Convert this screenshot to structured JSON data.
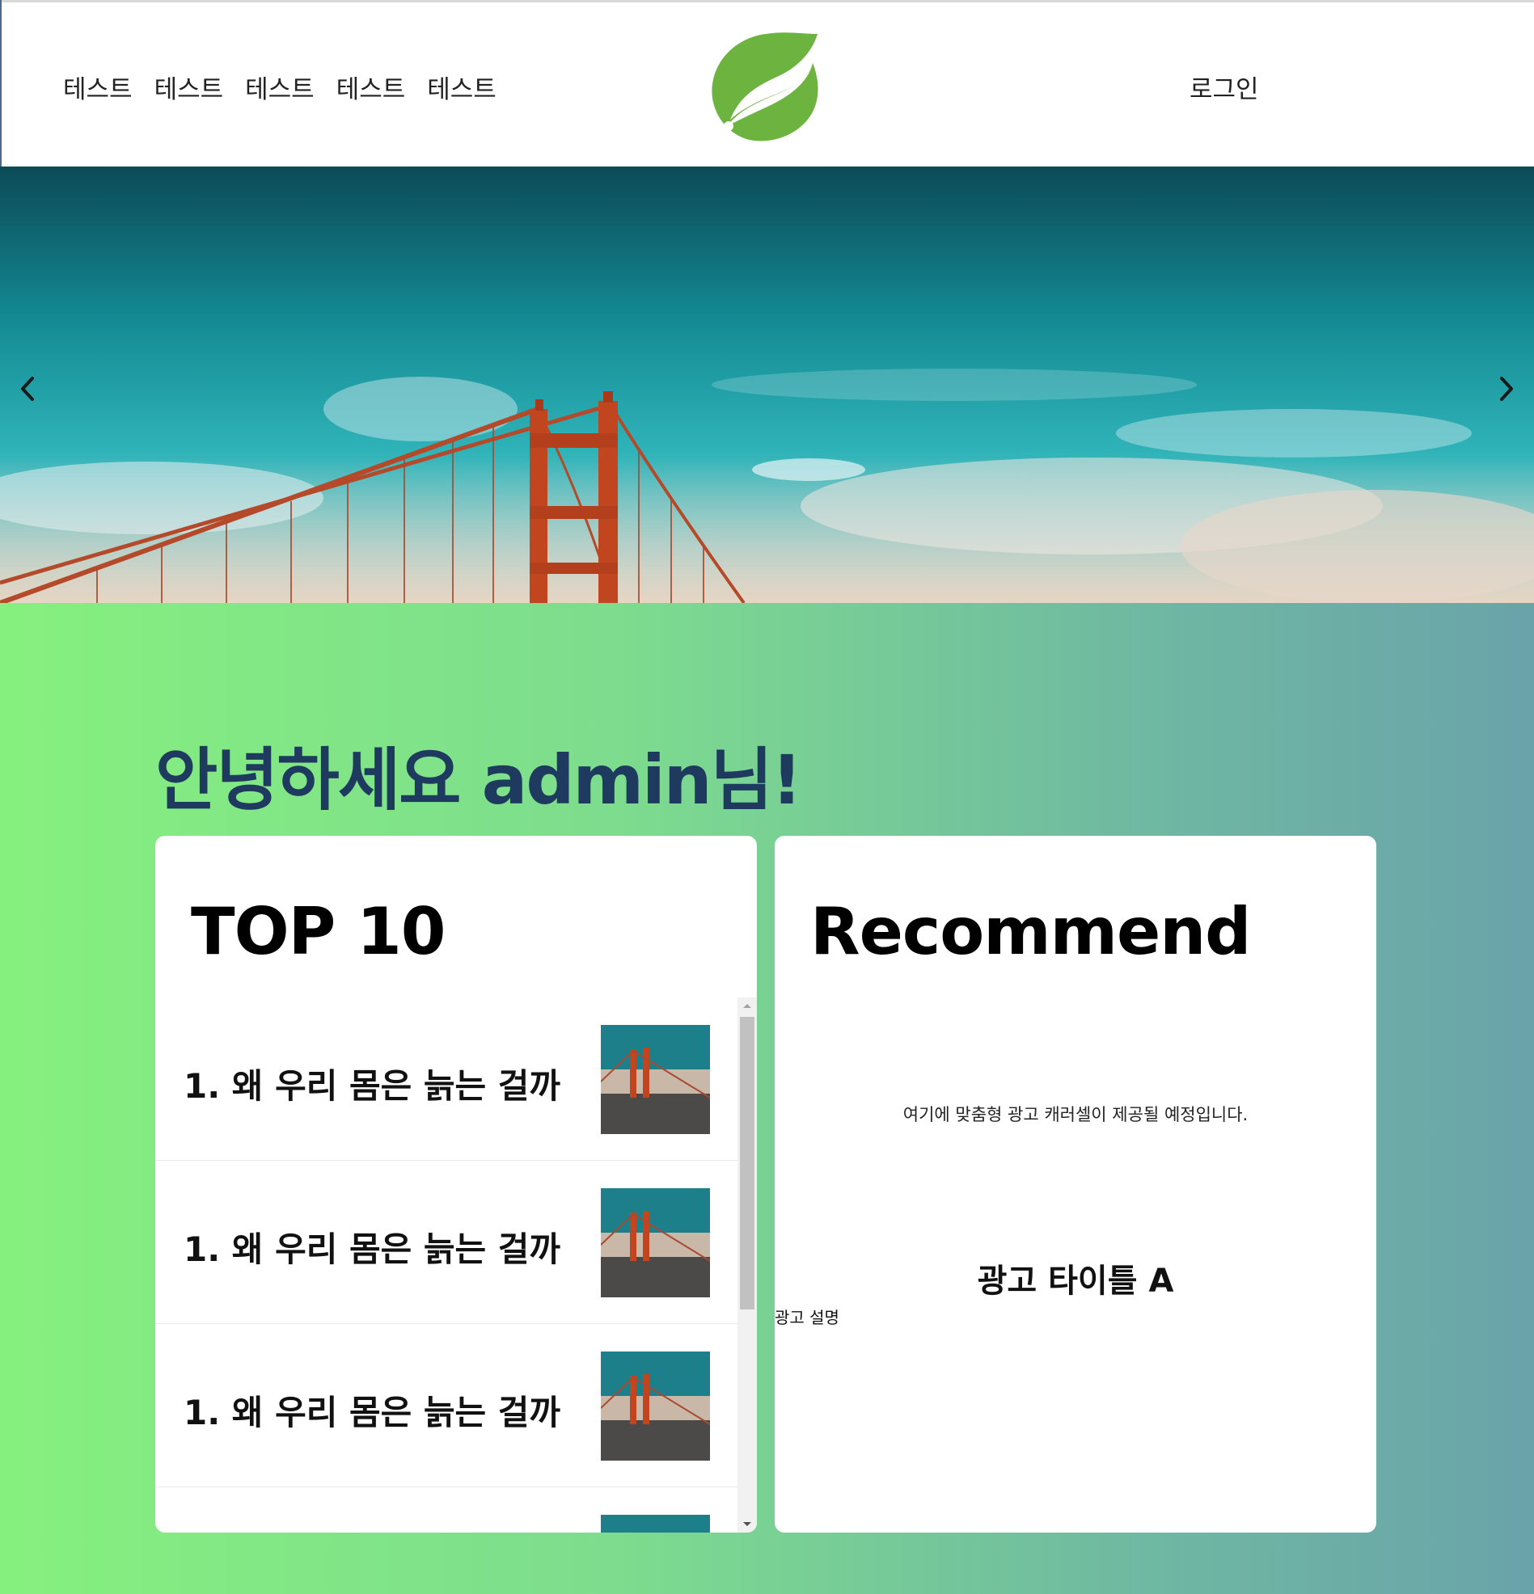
{
  "header": {
    "nav": [
      "테스트",
      "테스트",
      "테스트",
      "테스트",
      "테스트"
    ],
    "login": "로그인"
  },
  "hero": {
    "prev_icon": "chevron-left-icon",
    "next_icon": "chevron-right-icon"
  },
  "main": {
    "greeting": "안녕하세요 admin님!",
    "top10": {
      "title": "TOP 10",
      "items": [
        {
          "title": "1. 왜 우리 몸은 늙는 걸까"
        },
        {
          "title": "1. 왜 우리 몸은 늙는 걸까"
        },
        {
          "title": "1. 왜 우리 몸은 늙는 걸까"
        },
        {
          "title": ""
        }
      ]
    },
    "recommend": {
      "title": "Recommend",
      "description": "여기에 맞춤형 광고 캐러셀이 제공될 예정입니다.",
      "ad_title": "광고 타이틀 A",
      "ad_description": "광고 설명"
    }
  },
  "colors": {
    "greeting": "#1e3a5f",
    "logo": "#6db33f",
    "gradient_start": "#86f07e",
    "gradient_end": "#6aa3aa"
  }
}
